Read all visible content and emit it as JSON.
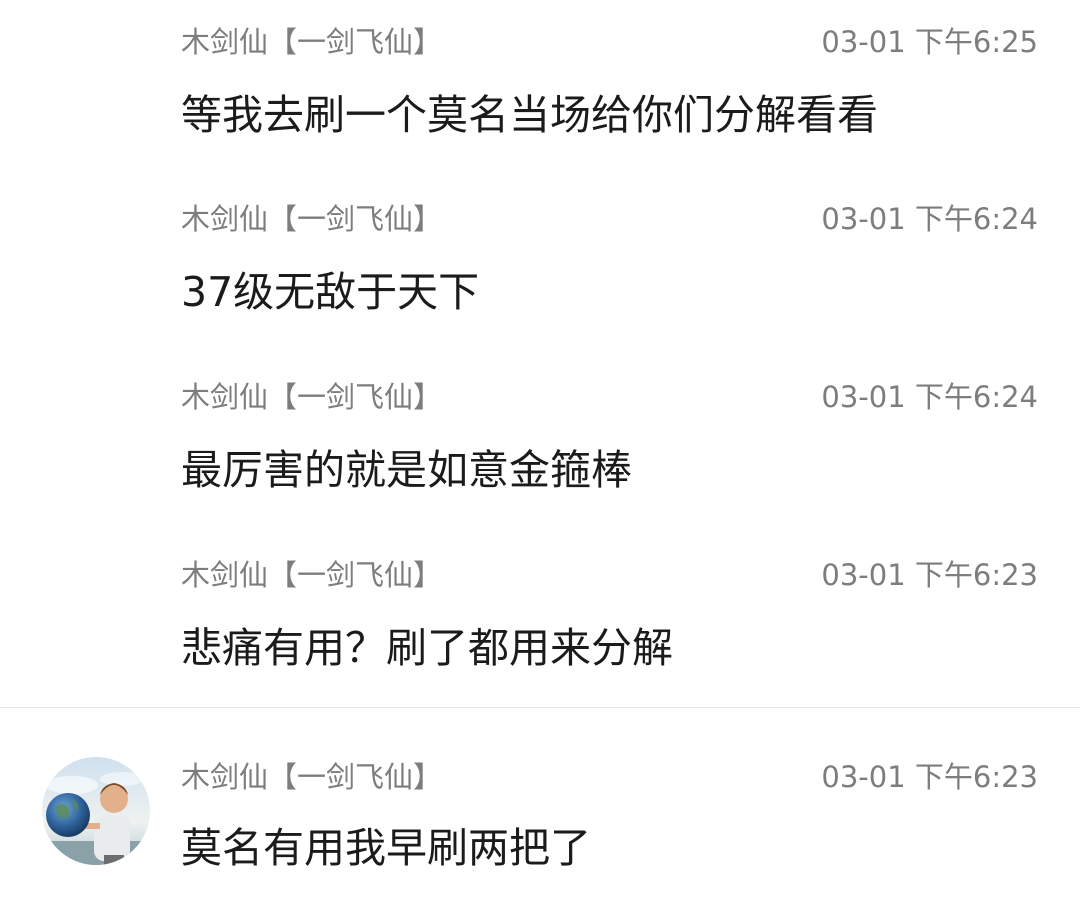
{
  "messages": [
    {
      "sender": "木剑仙【一剑飞仙】",
      "time": "03-01 下午6:25",
      "text": "等我去刷一个莫名当场给你们分解看看"
    },
    {
      "sender": "木剑仙【一剑飞仙】",
      "time": "03-01 下午6:24",
      "text": "37级无敌于天下"
    },
    {
      "sender": "木剑仙【一剑飞仙】",
      "time": "03-01 下午6:24",
      "text": "最厉害的就是如意金箍棒"
    },
    {
      "sender": "木剑仙【一剑飞仙】",
      "time": "03-01 下午6:23",
      "text": "悲痛有用？刷了都用来分解"
    },
    {
      "sender": "木剑仙【一剑飞仙】",
      "time": "03-01 下午6:23",
      "text": "莫名有用我早刷两把了"
    }
  ],
  "avatar": {
    "icon": "user-avatar-child-holding-globe"
  },
  "colors": {
    "meta": "#7d7d7d",
    "text": "#1b1b1b",
    "divider": "#e6e6e6"
  }
}
